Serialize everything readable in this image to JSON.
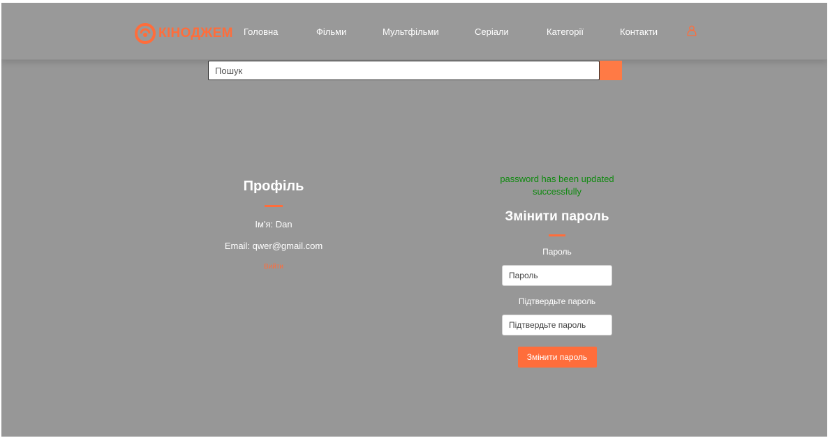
{
  "brand": {
    "name": "КІНОДЖЕМ",
    "accent_color": "#ff6d3b"
  },
  "nav": {
    "items": [
      "Головна",
      "Фільми",
      "Мультфільми",
      "Серіали",
      "Категорії",
      "Контакти"
    ],
    "user_icon": "user-icon"
  },
  "search": {
    "placeholder": "Пошук",
    "button_icon": "search-icon"
  },
  "profile": {
    "title": "Профіль",
    "name_label": "Ім'я:",
    "name_value": "Dan",
    "email_label": "Email:",
    "email_value": "qwer@gmail.com",
    "logout_label": "Вийти"
  },
  "change_password": {
    "success_message": "password has been updated successfully",
    "title": "Змінити пароль",
    "password_label": "Пароль",
    "password_placeholder": "Пароль",
    "confirm_label": "Підтвердьте пароль",
    "confirm_placeholder": "Підтвердьте пароль",
    "submit_label": "Змінити пароль",
    "success_color": "#0f8a0f"
  }
}
